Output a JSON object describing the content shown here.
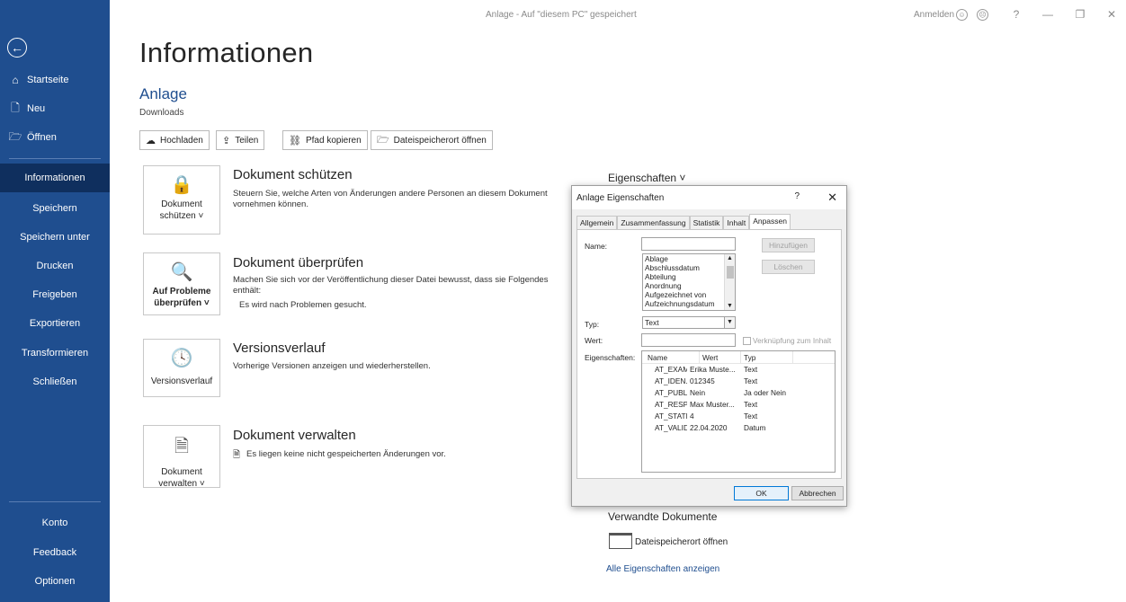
{
  "titlebar": {
    "title": "Anlage - Auf \"diesem PC\" gespeichert",
    "signin": "Anmelden",
    "help": "?",
    "minimize": "—",
    "restore": "❐",
    "close": "✕"
  },
  "sidebar": {
    "back": "←",
    "top_items": [
      {
        "label": "Startseite",
        "icon": "home-icon"
      },
      {
        "label": "Neu",
        "icon": "new-document-icon"
      },
      {
        "label": "Öffnen",
        "icon": "folder-open-icon"
      }
    ],
    "items": [
      "Informationen",
      "Speichern",
      "Speichern unter",
      "Drucken",
      "Freigeben",
      "Exportieren",
      "Transformieren",
      "Schließen"
    ],
    "active_index": 0,
    "bottom_items": [
      "Konto",
      "Feedback",
      "Optionen"
    ]
  },
  "main": {
    "title": "Informationen",
    "doc_name": "Anlage",
    "doc_location": "Downloads",
    "buttons": [
      "Hochladen",
      "Teilen",
      "Pfad kopieren",
      "Dateispeicherort öffnen"
    ],
    "sections": [
      {
        "card_label_1": "Dokument",
        "card_label_2": "schützen ˅",
        "title": "Dokument schützen",
        "text": "Steuern Sie, welche Arten von Änderungen andere Personen an diesem Dokument vornehmen können."
      },
      {
        "card_label_1": "Auf Probleme",
        "card_label_2": "überprüfen ˅",
        "title": "Dokument überprüfen",
        "text": "Machen Sie sich vor der Veröffentlichung dieser Datei bewusst, dass sie Folgendes enthält:",
        "bullet": "Es wird nach Problemen gesucht."
      },
      {
        "card_label_1": "Versionsverlauf",
        "card_label_2": "",
        "title": "Versionsverlauf",
        "text": "Vorherige Versionen anzeigen und wiederherstellen."
      },
      {
        "card_label_1": "Dokument",
        "card_label_2": "verwalten ˅",
        "title": "Dokument verwalten",
        "text": "Es liegen keine nicht gespeicherten Änderungen vor."
      }
    ],
    "right": {
      "properties_title": "Eigenschaften ˅",
      "related_title": "Verwandte Dokumente",
      "open_location": "Dateispeicherort öffnen",
      "all_properties": "Alle Eigenschaften anzeigen"
    }
  },
  "dialog": {
    "title": "Anlage Eigenschaften",
    "help": "?",
    "close": "✕",
    "tabs": [
      "Allgemein",
      "Zusammenfassung",
      "Statistik",
      "Inhalt",
      "Anpassen"
    ],
    "active_tab": 4,
    "name_label": "Name:",
    "name_value": "",
    "add_button": "Hinzufügen",
    "delete_button": "Löschen",
    "name_list": [
      "Ablage",
      "Abschlussdatum",
      "Abteilung",
      "Anordnung",
      "Aufgezeichnet von",
      "Aufzeichnungsdatum"
    ],
    "type_label": "Typ:",
    "type_value": "Text",
    "value_label": "Wert:",
    "value_value": "",
    "link_label": "Verknüpfung zum Inhalt",
    "props_label": "Eigenschaften:",
    "columns": [
      "Name",
      "Wert",
      "Typ"
    ],
    "rows": [
      [
        "AT_EXAM...",
        "Erika Muste...",
        "Text"
      ],
      [
        "AT_IDEN...",
        "012345",
        "Text"
      ],
      [
        "AT_PUBLI...",
        "Nein",
        "Ja oder Nein"
      ],
      [
        "AT_RESP...",
        "Max Muster...",
        "Text"
      ],
      [
        "AT_STATE",
        "4",
        "Text"
      ],
      [
        "AT_VALID...",
        "22.04.2020",
        "Datum"
      ]
    ],
    "ok": "OK",
    "cancel": "Abbrechen"
  }
}
